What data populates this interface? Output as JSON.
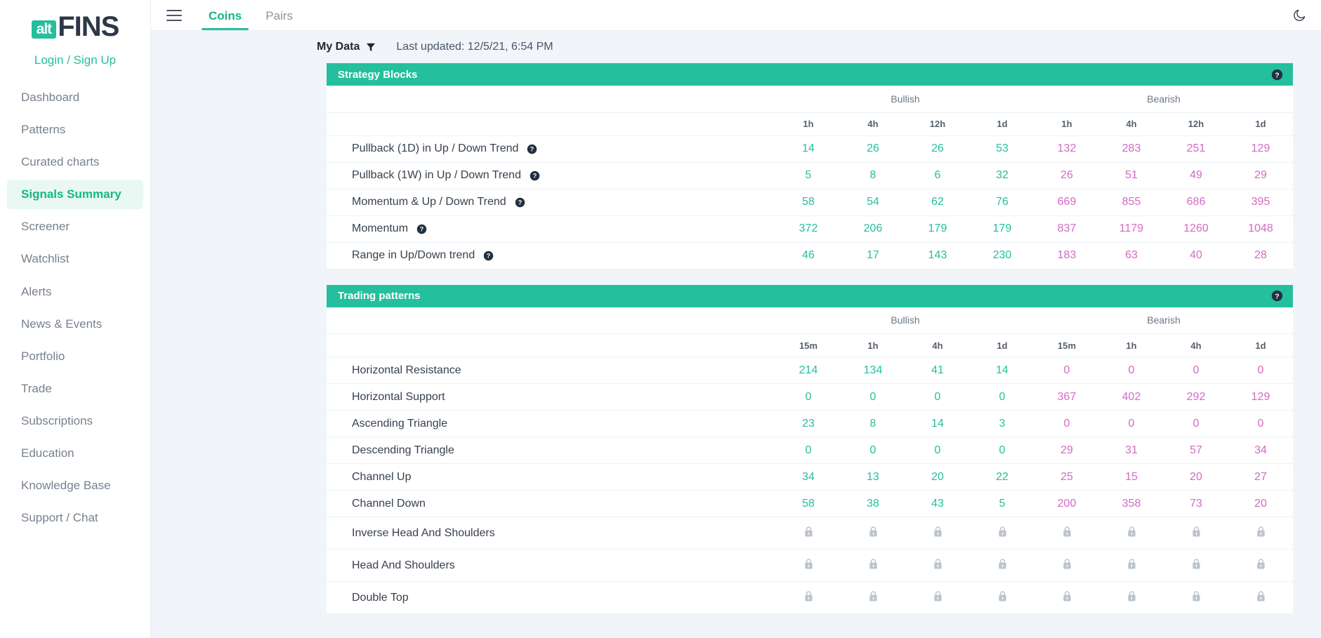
{
  "brand": {
    "logo_alt": "alt",
    "logo_main": "FINS",
    "login_label": "Login / Sign Up"
  },
  "sidebar": {
    "items": [
      {
        "label": "Dashboard",
        "active": false
      },
      {
        "label": "Patterns",
        "active": false
      },
      {
        "label": "Curated charts",
        "active": false
      },
      {
        "label": "Signals Summary",
        "active": true
      },
      {
        "label": "Screener",
        "active": false
      },
      {
        "label": "Watchlist",
        "active": false
      },
      {
        "label": "Alerts",
        "active": false
      },
      {
        "label": "News & Events",
        "active": false
      },
      {
        "label": "Portfolio",
        "active": false
      },
      {
        "label": "Trade",
        "active": false
      },
      {
        "label": "Subscriptions",
        "active": false
      },
      {
        "label": "Education",
        "active": false
      },
      {
        "label": "Knowledge Base",
        "active": false
      },
      {
        "label": "Support / Chat",
        "active": false
      }
    ]
  },
  "topbar": {
    "menu_icon": "hamburger-icon",
    "tabs": [
      {
        "label": "Coins",
        "active": true
      },
      {
        "label": "Pairs",
        "active": false
      }
    ],
    "theme_toggle_icon": "moon-icon"
  },
  "subbar": {
    "my_data_label": "My Data",
    "filter_icon": "funnel-icon",
    "last_updated": "Last updated: 12/5/21, 6:54 PM"
  },
  "colors": {
    "accent": "#24bf9d",
    "bullish": "#24bf9d",
    "bearish": "#d46ac4",
    "locked": "#b8c0c9",
    "page_bg": "#f1f5f9"
  },
  "strategy_blocks": {
    "title": "Strategy Blocks",
    "help_icon": "question-circle-icon",
    "groups": [
      "Bullish",
      "Bearish"
    ],
    "timeframes": [
      "1h",
      "4h",
      "12h",
      "1d",
      "1h",
      "4h",
      "12h",
      "1d"
    ],
    "rows": [
      {
        "label": "Pullback (1D) in Up / Down Trend",
        "has_help": true,
        "locked": false,
        "values": [
          "14",
          "26",
          "26",
          "53",
          "132",
          "283",
          "251",
          "129"
        ]
      },
      {
        "label": "Pullback (1W) in Up / Down Trend",
        "has_help": true,
        "locked": false,
        "values": [
          "5",
          "8",
          "6",
          "32",
          "26",
          "51",
          "49",
          "29"
        ]
      },
      {
        "label": "Momentum & Up / Down Trend",
        "has_help": true,
        "locked": false,
        "values": [
          "58",
          "54",
          "62",
          "76",
          "669",
          "855",
          "686",
          "395"
        ]
      },
      {
        "label": "Momentum",
        "has_help": true,
        "locked": false,
        "values": [
          "372",
          "206",
          "179",
          "179",
          "837",
          "1179",
          "1260",
          "1048"
        ]
      },
      {
        "label": "Range in Up/Down trend",
        "has_help": true,
        "locked": false,
        "values": [
          "46",
          "17",
          "143",
          "230",
          "183",
          "63",
          "40",
          "28"
        ]
      }
    ]
  },
  "trading_patterns": {
    "title": "Trading patterns",
    "help_icon": "question-circle-icon",
    "groups": [
      "Bullish",
      "Bearish"
    ],
    "timeframes": [
      "15m",
      "1h",
      "4h",
      "1d",
      "15m",
      "1h",
      "4h",
      "1d"
    ],
    "rows": [
      {
        "label": "Horizontal Resistance",
        "has_help": false,
        "locked": false,
        "values": [
          "214",
          "134",
          "41",
          "14",
          "0",
          "0",
          "0",
          "0"
        ]
      },
      {
        "label": "Horizontal Support",
        "has_help": false,
        "locked": false,
        "values": [
          "0",
          "0",
          "0",
          "0",
          "367",
          "402",
          "292",
          "129"
        ]
      },
      {
        "label": "Ascending Triangle",
        "has_help": false,
        "locked": false,
        "values": [
          "23",
          "8",
          "14",
          "3",
          "0",
          "0",
          "0",
          "0"
        ]
      },
      {
        "label": "Descending Triangle",
        "has_help": false,
        "locked": false,
        "values": [
          "0",
          "0",
          "0",
          "0",
          "29",
          "31",
          "57",
          "34"
        ]
      },
      {
        "label": "Channel Up",
        "has_help": false,
        "locked": false,
        "values": [
          "34",
          "13",
          "20",
          "22",
          "25",
          "15",
          "20",
          "27"
        ]
      },
      {
        "label": "Channel Down",
        "has_help": false,
        "locked": false,
        "values": [
          "58",
          "38",
          "43",
          "5",
          "200",
          "358",
          "73",
          "20"
        ]
      },
      {
        "label": "Inverse Head And Shoulders",
        "has_help": false,
        "locked": true,
        "values": [
          "lock",
          "lock",
          "lock",
          "lock",
          "lock",
          "lock",
          "lock",
          "lock"
        ]
      },
      {
        "label": "Head And Shoulders",
        "has_help": false,
        "locked": true,
        "values": [
          "lock",
          "lock",
          "lock",
          "lock",
          "lock",
          "lock",
          "lock",
          "lock"
        ]
      },
      {
        "label": "Double Top",
        "has_help": false,
        "locked": true,
        "values": [
          "lock",
          "lock",
          "lock",
          "lock",
          "lock",
          "lock",
          "lock",
          "lock"
        ]
      }
    ]
  }
}
